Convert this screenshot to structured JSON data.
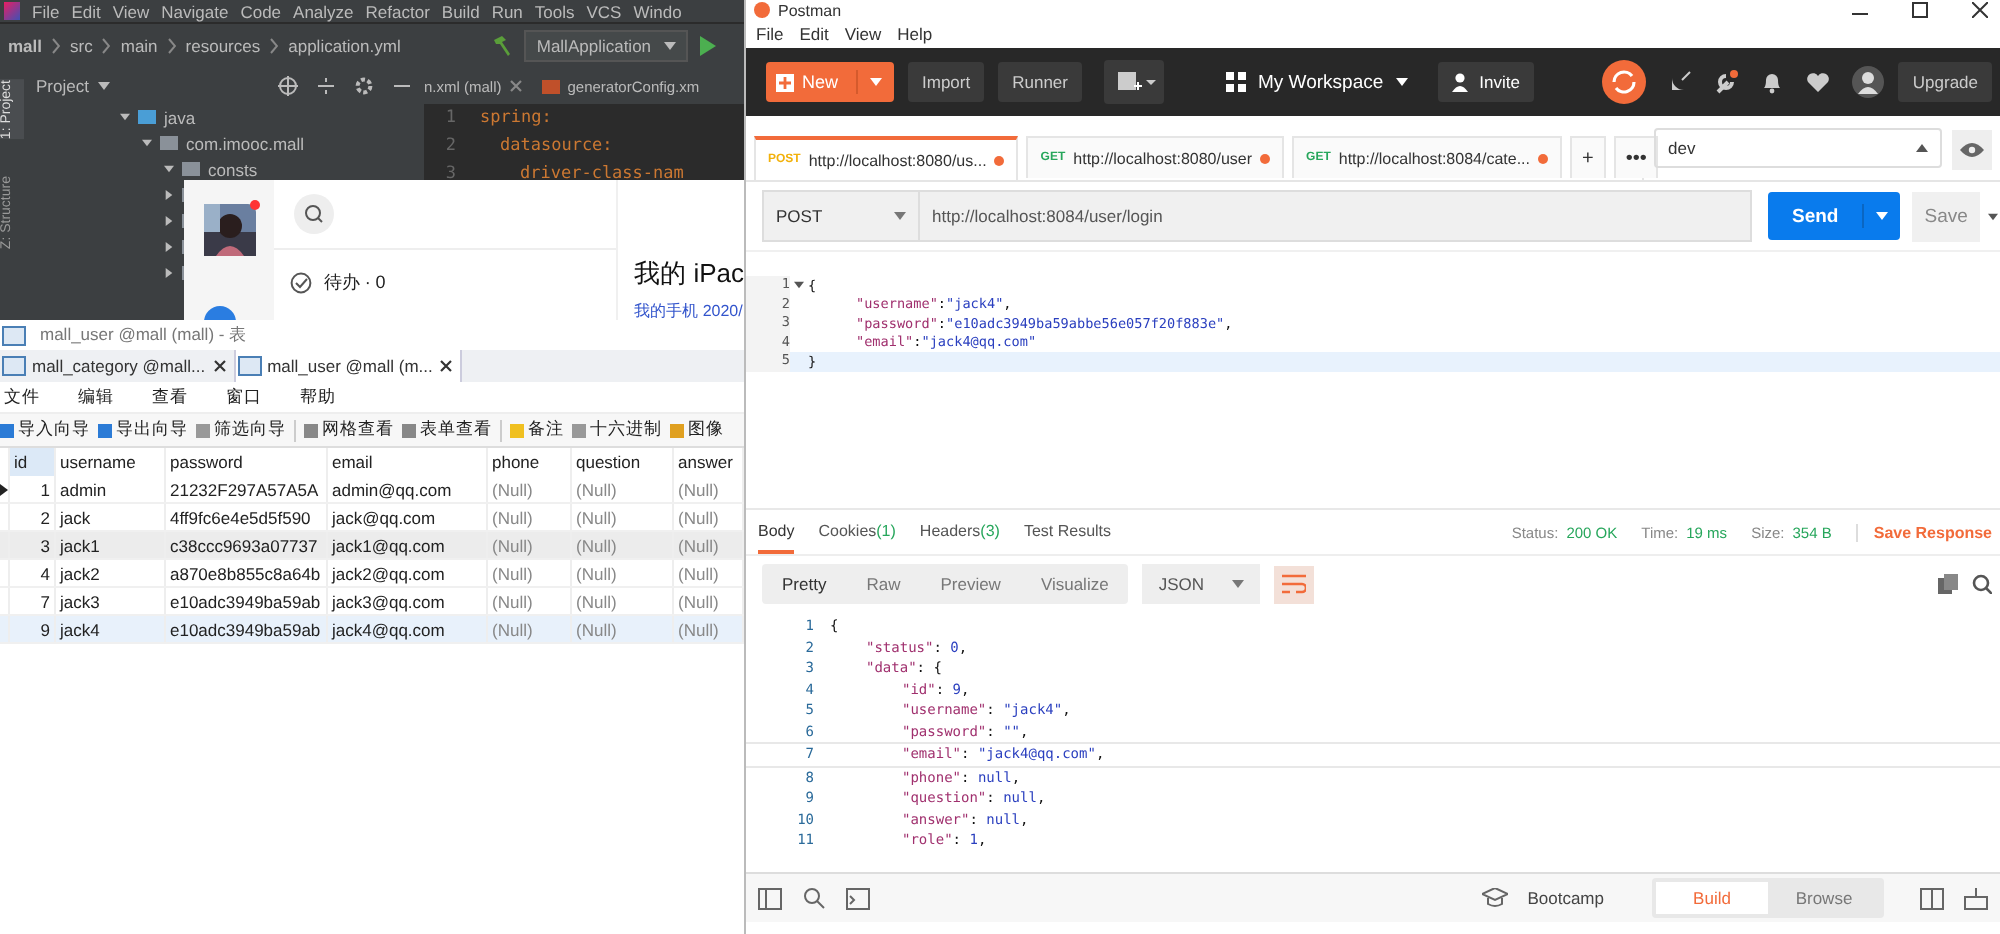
{
  "ide": {
    "menu": [
      "File",
      "Edit",
      "View",
      "Navigate",
      "Code",
      "Analyze",
      "Refactor",
      "Build",
      "Run",
      "Tools",
      "VCS",
      "Windo"
    ],
    "breadcrumbs": [
      "mall",
      "src",
      "main",
      "resources",
      "application.yml"
    ],
    "run_config": "MallApplication",
    "side_tabs": [
      {
        "label": "1: Project",
        "selected": true
      },
      {
        "label": "Z: Structure",
        "selected": false
      }
    ],
    "project_title": "Project",
    "tree": [
      {
        "label": "java",
        "expanded": true,
        "children": [
          {
            "label": "com.imooc.mall",
            "expanded": true,
            "children": [
              {
                "label": "consts",
                "expanded": true
              }
            ]
          }
        ]
      }
    ],
    "hidden_folders": [
      {
        "expanded": false
      },
      {
        "expanded": false
      },
      {
        "expanded": false
      },
      {
        "expanded": false
      }
    ],
    "editor_tabs": [
      "n.xml (mall)",
      "generatorConfig.xm"
    ],
    "code": [
      {
        "n": "1",
        "text": "spring:"
      },
      {
        "n": "2",
        "text": "datasource:"
      },
      {
        "n": "3",
        "text": "driver-class-nam"
      }
    ]
  },
  "chat": {
    "todo": "待办 · 0",
    "heading": "我的 iPac",
    "subtitle": "我的手机 2020/"
  },
  "navicat": {
    "title": "mall_user @mall (mall) - 表",
    "tabs": [
      {
        "label": "mall_category @mall...",
        "selected": false
      },
      {
        "label": "mall_user @mall (m...",
        "selected": true
      }
    ],
    "menu": [
      "文件",
      "编辑",
      "查看",
      "窗口",
      "帮助"
    ],
    "toolbar": [
      {
        "label": "导入向导",
        "kind": "import"
      },
      {
        "label": "导出向导",
        "kind": "export"
      },
      {
        "label": "筛选向导",
        "kind": "filter"
      },
      {
        "label": "网格查看",
        "kind": "grid"
      },
      {
        "label": "表单查看",
        "kind": "form"
      },
      {
        "label": "备注",
        "kind": "note"
      },
      {
        "label": "十六进制",
        "kind": "hex"
      },
      {
        "label": "图像"
      }
    ],
    "columns": [
      "id",
      "username",
      "password",
      "email",
      "phone",
      "question",
      "answer"
    ],
    "rows": [
      {
        "cells": [
          "1",
          "admin",
          "21232F297A57A5A",
          "admin@qq.com",
          "(Null)",
          "(Null)",
          "(Null)"
        ],
        "current": true,
        "hovered": false,
        "selected": false
      },
      {
        "cells": [
          "2",
          "jack",
          "4ff9fc6e4e5d5f590",
          "jack@qq.com",
          "(Null)",
          "(Null)",
          "(Null)"
        ],
        "current": false,
        "hovered": false,
        "selected": false
      },
      {
        "cells": [
          "3",
          "jack1",
          "c38ccc9693a07737",
          "jack1@qq.com",
          "(Null)",
          "(Null)",
          "(Null)"
        ],
        "current": false,
        "hovered": true,
        "selected": false
      },
      {
        "cells": [
          "4",
          "jack2",
          "a870e8b855c8a64b",
          "jack2@qq.com",
          "(Null)",
          "(Null)",
          "(Null)"
        ],
        "current": false,
        "hovered": false,
        "selected": false
      },
      {
        "cells": [
          "7",
          "jack3",
          "e10adc3949ba59ab",
          "jack3@qq.com",
          "(Null)",
          "(Null)",
          "(Null)"
        ],
        "current": false,
        "hovered": false,
        "selected": false
      },
      {
        "cells": [
          "9",
          "jack4",
          "e10adc3949ba59ab",
          "jack4@qq.com",
          "(Null)",
          "(Null)",
          "(Null)"
        ],
        "current": false,
        "hovered": false,
        "selected": true
      }
    ]
  },
  "postman": {
    "title": "Postman",
    "menu": [
      "File",
      "Edit",
      "View",
      "Help"
    ],
    "header": {
      "new": "New",
      "import": "Import",
      "runner": "Runner",
      "workspace": "My Workspace",
      "invite": "Invite",
      "upgrade": "Upgrade"
    },
    "tabs": [
      {
        "method": "POST",
        "url": "http://localhost:8080/us...",
        "selected": true,
        "unsaved": true
      },
      {
        "method": "GET",
        "url": "http://localhost:8080/user",
        "selected": false,
        "unsaved": true
      },
      {
        "method": "GET",
        "url": "http://localhost:8084/cate...",
        "selected": false,
        "unsaved": true
      }
    ],
    "add_tab": "+",
    "more": "•••",
    "environment": "dev",
    "request": {
      "method": "POST",
      "url": "http://localhost:8084/user/login",
      "send": "Send",
      "save": "Save"
    },
    "body": [
      {
        "n": "1",
        "parts": [
          {
            "kind": "punct",
            "text": "{"
          }
        ],
        "children": [
          {
            "n": "2",
            "parts": [
              {
                "kind": "key",
                "text": "\"username\""
              },
              {
                "kind": "punct",
                "text": ":"
              },
              {
                "kind": "str",
                "text": "\"jack4\""
              },
              {
                "kind": "punct",
                "text": ","
              }
            ]
          },
          {
            "n": "3",
            "parts": [
              {
                "kind": "key",
                "text": "\"password\""
              },
              {
                "kind": "punct",
                "text": ":"
              },
              {
                "kind": "str",
                "text": "\"e10adc3949ba59abbe56e057f20f883e\""
              },
              {
                "kind": "punct",
                "text": ","
              }
            ]
          },
          {
            "n": "4",
            "parts": [
              {
                "kind": "key",
                "text": "\"email\""
              },
              {
                "kind": "punct",
                "text": ":"
              },
              {
                "kind": "str",
                "text": "\"jack4@qq.com\""
              }
            ]
          }
        ]
      },
      {
        "n": "5",
        "parts": [
          {
            "kind": "punct",
            "text": "}"
          }
        ],
        "current": true
      }
    ],
    "response_tabs": [
      {
        "label": "Body",
        "selected": true
      },
      {
        "label": "Cookies",
        "count": "(1)",
        "selected": false
      },
      {
        "label": "Headers",
        "count": "(3)",
        "selected": false
      },
      {
        "label": "Test Results",
        "selected": false
      }
    ],
    "status": {
      "status_label": "Status:",
      "status": "200 OK",
      "time_label": "Time:",
      "time": "19 ms",
      "size_label": "Size:",
      "size": "354 B",
      "save_response": "Save Response"
    },
    "views": [
      {
        "label": "Pretty",
        "selected": true
      },
      {
        "label": "Raw",
        "selected": false
      },
      {
        "label": "Preview",
        "selected": false
      },
      {
        "label": "Visualize",
        "selected": false
      }
    ],
    "format": "JSON",
    "response": [
      {
        "n": "1",
        "parts": [
          {
            "kind": "punct",
            "text": "{"
          }
        ],
        "children": [
          {
            "n": "2",
            "parts": [
              {
                "kind": "key",
                "text": "\"status\""
              },
              {
                "kind": "punct",
                "text": ": "
              },
              {
                "kind": "num",
                "text": "0"
              },
              {
                "kind": "punct",
                "text": ","
              }
            ]
          },
          {
            "n": "3",
            "parts": [
              {
                "kind": "key",
                "text": "\"data\""
              },
              {
                "kind": "punct",
                "text": ": {"
              }
            ],
            "children": [
              {
                "n": "4",
                "parts": [
                  {
                    "kind": "key",
                    "text": "\"id\""
                  },
                  {
                    "kind": "punct",
                    "text": ": "
                  },
                  {
                    "kind": "num",
                    "text": "9"
                  },
                  {
                    "kind": "punct",
                    "text": ","
                  }
                ]
              },
              {
                "n": "5",
                "parts": [
                  {
                    "kind": "key",
                    "text": "\"username\""
                  },
                  {
                    "kind": "punct",
                    "text": ": "
                  },
                  {
                    "kind": "str",
                    "text": "\"jack4\""
                  },
                  {
                    "kind": "punct",
                    "text": ","
                  }
                ]
              },
              {
                "n": "6",
                "parts": [
                  {
                    "kind": "key",
                    "text": "\"password\""
                  },
                  {
                    "kind": "punct",
                    "text": ": "
                  },
                  {
                    "kind": "str",
                    "text": "\"\""
                  },
                  {
                    "kind": "punct",
                    "text": ","
                  }
                ]
              },
              {
                "n": "7",
                "parts": [
                  {
                    "kind": "key",
                    "text": "\"email\""
                  },
                  {
                    "kind": "punct",
                    "text": ": "
                  },
                  {
                    "kind": "str",
                    "text": "\"jack4@qq.com\""
                  },
                  {
                    "kind": "punct",
                    "text": ","
                  }
                ],
                "current": true
              },
              {
                "n": "8",
                "parts": [
                  {
                    "kind": "key",
                    "text": "\"phone\""
                  },
                  {
                    "kind": "punct",
                    "text": ": "
                  },
                  {
                    "kind": "num",
                    "text": "null"
                  },
                  {
                    "kind": "punct",
                    "text": ","
                  }
                ]
              },
              {
                "n": "9",
                "parts": [
                  {
                    "kind": "key",
                    "text": "\"question\""
                  },
                  {
                    "kind": "punct",
                    "text": ": "
                  },
                  {
                    "kind": "num",
                    "text": "null"
                  },
                  {
                    "kind": "punct",
                    "text": ","
                  }
                ]
              },
              {
                "n": "10",
                "parts": [
                  {
                    "kind": "key",
                    "text": "\"answer\""
                  },
                  {
                    "kind": "punct",
                    "text": ": "
                  },
                  {
                    "kind": "num",
                    "text": "null"
                  },
                  {
                    "kind": "punct",
                    "text": ","
                  }
                ]
              },
              {
                "n": "11",
                "parts": [
                  {
                    "kind": "key",
                    "text": "\"role\""
                  },
                  {
                    "kind": "punct",
                    "text": ": "
                  },
                  {
                    "kind": "num",
                    "text": "1"
                  },
                  {
                    "kind": "punct",
                    "text": ","
                  }
                ]
              }
            ]
          }
        ]
      }
    ],
    "footer": {
      "bootcamp": "Bootcamp",
      "modes": [
        {
          "label": "Build",
          "selected": true
        },
        {
          "label": "Browse",
          "selected": false
        }
      ]
    }
  }
}
